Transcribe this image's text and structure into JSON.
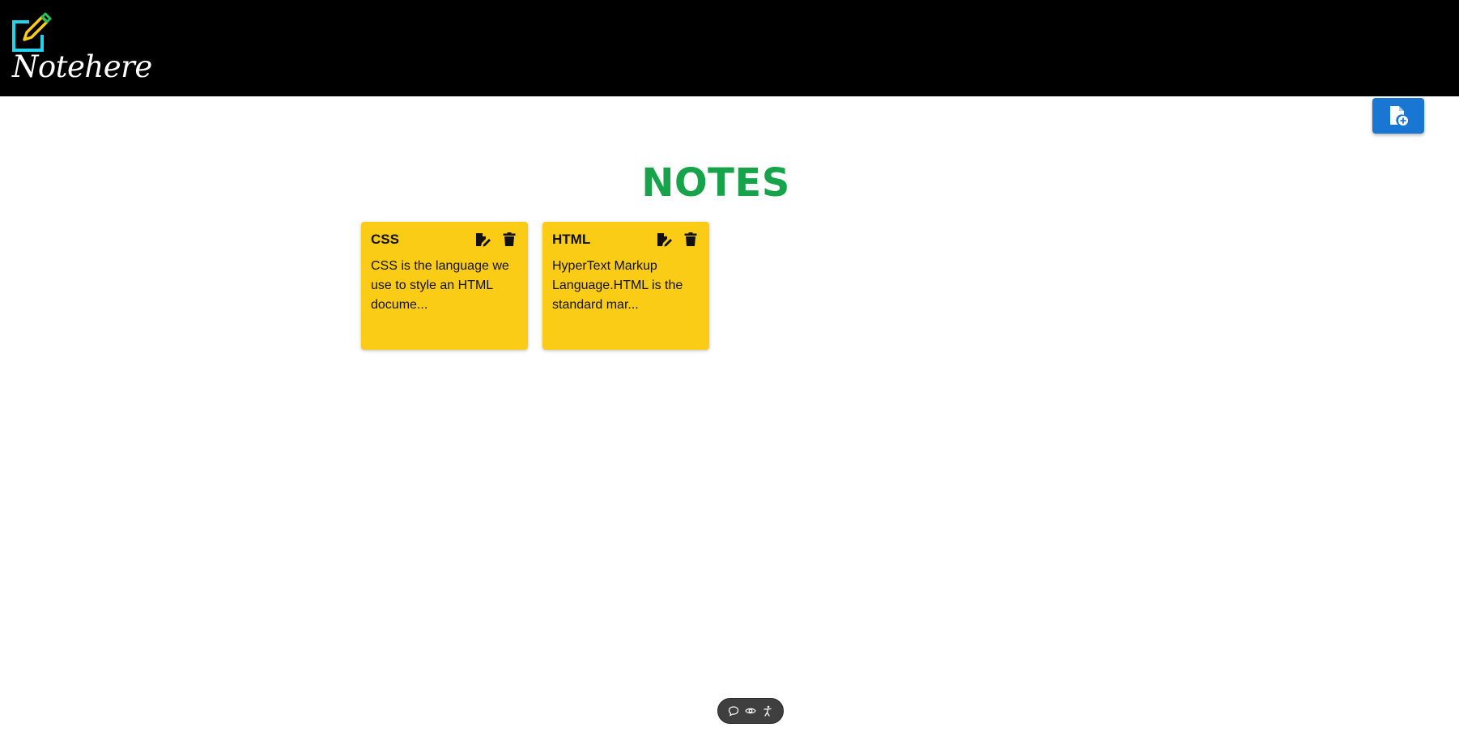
{
  "app": {
    "brand": "Notehere"
  },
  "main": {
    "heading": "NOTES",
    "add_button_icon": "add-note-icon"
  },
  "notes": [
    {
      "title": "CSS",
      "body": "CSS is the language we use to style an HTML docume..."
    },
    {
      "title": "HTML",
      "body": "HyperText Markup Language.HTML is the standard mar..."
    }
  ],
  "colors": {
    "topbar": "#000000",
    "heading": "#16a34a",
    "note_card": "#facc15",
    "add_button": "#1976d2",
    "logo_square": "#22d3ee",
    "logo_pencil": "#facc15",
    "logo_pencil_tip": "#22c55e"
  },
  "floating_toolbar": {
    "icons": [
      "chat-bubble-icon",
      "eye-icon",
      "accessibility-icon"
    ]
  }
}
